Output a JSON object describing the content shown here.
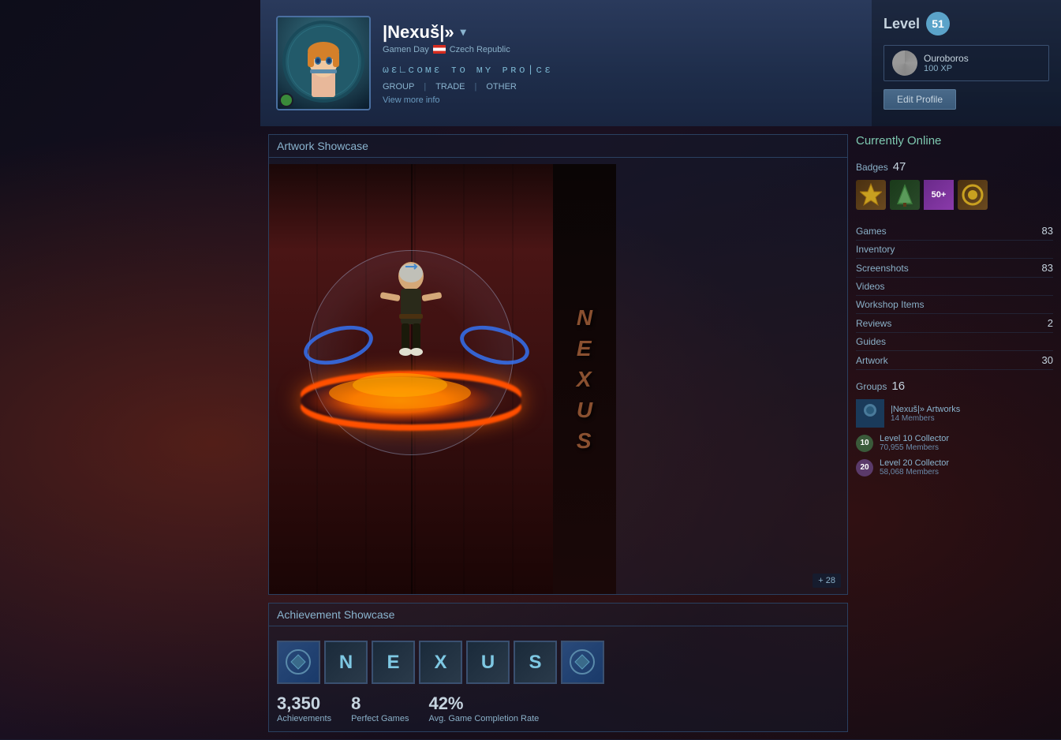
{
  "background": {
    "color": "#1a1020"
  },
  "profile": {
    "name": "|Nexuš|»",
    "name_suffix": "▾",
    "subtitle": "Gamen Day",
    "country": "Czech Republic",
    "motto": "ωε∟ᴄᴏмε ᴛᴏ мʏ ᴘʀᴏ|ᴄε",
    "links": [
      "GROUP",
      "TRADE",
      "OTHER"
    ],
    "view_more": "View more info",
    "level_label": "Level",
    "level_value": "51",
    "xp_name": "Ouroboros",
    "xp_value": "100 XP",
    "edit_profile": "Edit Profile"
  },
  "currently_online": {
    "label": "Currently Online"
  },
  "badges": {
    "label": "Badges",
    "count": "47"
  },
  "stats": [
    {
      "label": "Games",
      "value": "83"
    },
    {
      "label": "Inventory",
      "value": ""
    },
    {
      "label": "Screenshots",
      "value": "83"
    },
    {
      "label": "Videos",
      "value": ""
    },
    {
      "label": "Workshop Items",
      "value": ""
    },
    {
      "label": "Reviews",
      "value": "2"
    },
    {
      "label": "Guides",
      "value": ""
    },
    {
      "label": "Artwork",
      "value": "30"
    }
  ],
  "groups": {
    "label": "Groups",
    "count": "16",
    "items": [
      {
        "name": "|Nexuš|» Artworks",
        "members": "14 Members"
      },
      {
        "name": "Level 10 Collector",
        "members": "70,955 Members",
        "level": "10"
      },
      {
        "name": "Level 20 Collector",
        "members": "58,068 Members",
        "level": "20"
      }
    ]
  },
  "artwork": {
    "title": "Artwork Showcase",
    "nexus_letters": [
      "N",
      "E",
      "X",
      "U",
      "S"
    ],
    "plus_more": "+ 28"
  },
  "achievements": {
    "title": "Achievement Showcase",
    "letters": [
      "N",
      "E",
      "X",
      "U",
      "S"
    ],
    "total": "3,350",
    "total_label": "Achievements",
    "perfect_games": "8",
    "perfect_label": "Perfect Games",
    "completion_rate": "42%",
    "completion_label": "Avg. Game Completion Rate"
  }
}
